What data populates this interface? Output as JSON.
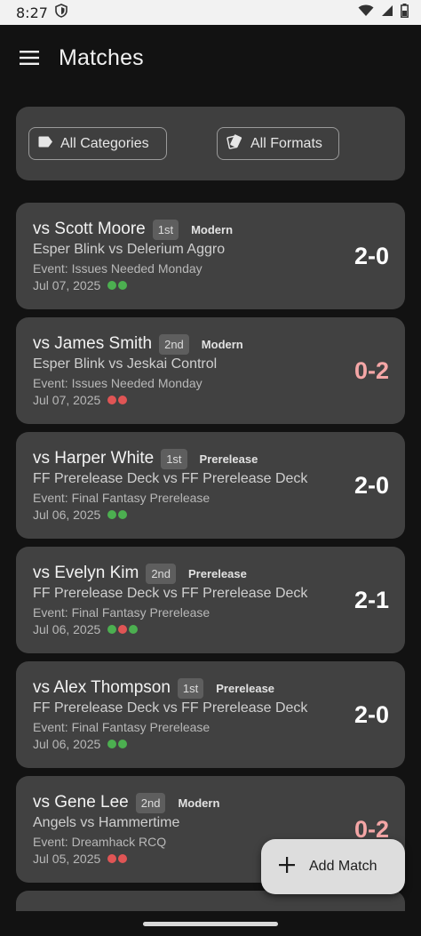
{
  "status": {
    "time": "8:27"
  },
  "app": {
    "title": "Matches"
  },
  "filters": {
    "categories_label": "All Categories",
    "formats_label": "All Formats"
  },
  "colors": {
    "win": "#4caf50",
    "loss": "#e05555",
    "score_win": "#ffffff",
    "score_loss": "#f4a6a6"
  },
  "matches": [
    {
      "opponent": "vs Scott Moore",
      "seat": "1st",
      "format": "Modern",
      "decks": "Esper Blink vs Delerium Aggro",
      "event": "Event: Issues Needed Monday",
      "date": "Jul 07, 2025",
      "games": [
        "W",
        "W"
      ],
      "score": "2-0",
      "result": "win"
    },
    {
      "opponent": "vs James Smith",
      "seat": "2nd",
      "format": "Modern",
      "decks": "Esper Blink vs Jeskai Control",
      "event": "Event: Issues Needed Monday",
      "date": "Jul 07, 2025",
      "games": [
        "L",
        "L"
      ],
      "score": "0-2",
      "result": "loss"
    },
    {
      "opponent": "vs Harper White",
      "seat": "1st",
      "format": "Prerelease",
      "decks": "FF Prerelease Deck vs FF Prerelease Deck",
      "event": "Event: Final Fantasy Prerelease",
      "date": "Jul 06, 2025",
      "games": [
        "W",
        "W"
      ],
      "score": "2-0",
      "result": "win"
    },
    {
      "opponent": "vs Evelyn Kim",
      "seat": "2nd",
      "format": "Prerelease",
      "decks": "FF Prerelease Deck vs FF Prerelease Deck",
      "event": "Event: Final Fantasy Prerelease",
      "date": "Jul 06, 2025",
      "games": [
        "W",
        "L",
        "W"
      ],
      "score": "2-1",
      "result": "win"
    },
    {
      "opponent": "vs Alex Thompson",
      "seat": "1st",
      "format": "Prerelease",
      "decks": "FF Prerelease Deck vs FF Prerelease Deck",
      "event": "Event: Final Fantasy Prerelease",
      "date": "Jul 06, 2025",
      "games": [
        "W",
        "W"
      ],
      "score": "2-0",
      "result": "win"
    },
    {
      "opponent": "vs Gene Lee",
      "seat": "2nd",
      "format": "Modern",
      "decks": "Angels vs Hammertime",
      "event": "Event: Dreamhack RCQ",
      "date": "Jul 05, 2025",
      "games": [
        "L",
        "L"
      ],
      "score": "0-2",
      "result": "loss"
    }
  ],
  "fab": {
    "label": "Add Match"
  }
}
